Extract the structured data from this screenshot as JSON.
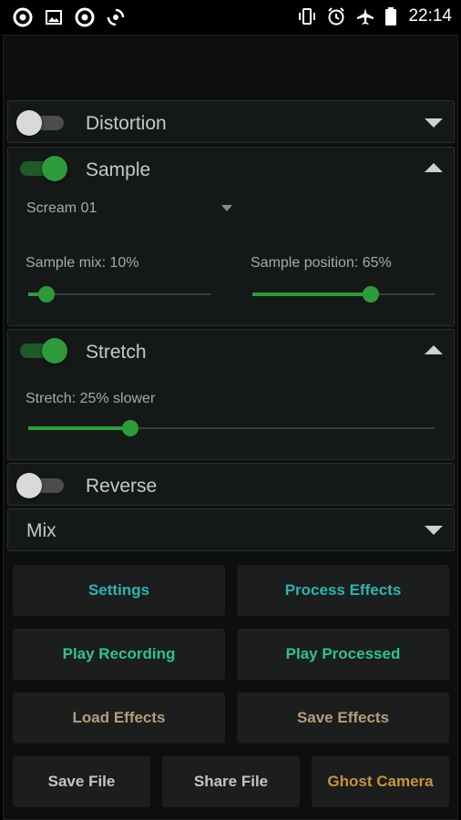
{
  "status_bar": {
    "time": "22:14",
    "left_icons": [
      "app-a-icon",
      "image-icon",
      "app-a-icon",
      "sync-icon"
    ],
    "right_icons": [
      "vibrate-icon",
      "alarm-icon",
      "airplane-icon",
      "battery-icon"
    ]
  },
  "effects": {
    "distortion": {
      "title": "Distortion",
      "enabled": false
    },
    "sample": {
      "title": "Sample",
      "enabled": true,
      "selected_sample": "Scream 01",
      "mix_label": "Sample mix: 10%",
      "mix_value": 0.1,
      "position_label": "Sample position: 65%",
      "position_value": 0.65
    },
    "stretch": {
      "title": "Stretch",
      "enabled": true,
      "label": "Stretch: 25% slower",
      "value": 0.25
    },
    "reverse": {
      "title": "Reverse",
      "enabled": false
    },
    "mix": {
      "title": "Mix"
    }
  },
  "buttons": {
    "settings": "Settings",
    "process_effects": "Process Effects",
    "play_recording": "Play Recording",
    "play_processed": "Play Processed",
    "load_effects": "Load Effects",
    "save_effects": "Save Effects",
    "save_file": "Save File",
    "share_file": "Share File",
    "ghost_camera": "Ghost Camera"
  },
  "colors": {
    "accent_green": "#2e9b3a",
    "cyan_text": "#2fb3b3",
    "green_text": "#2fc48a",
    "tan_text": "#b89a7e",
    "gold_text": "#c9923c"
  }
}
